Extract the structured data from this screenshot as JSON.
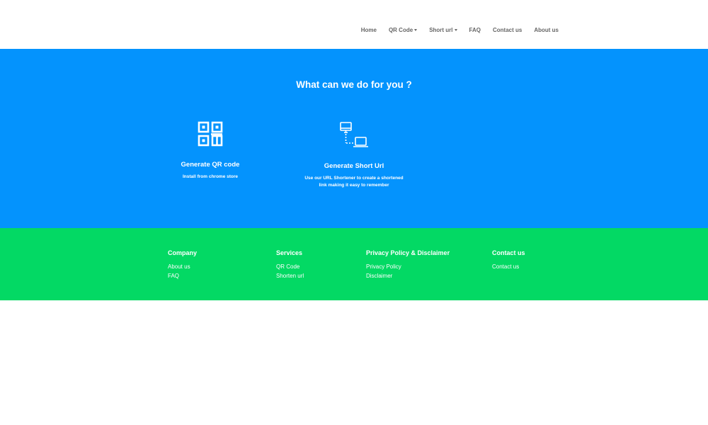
{
  "nav": {
    "items": [
      {
        "label": "Home",
        "dropdown": false
      },
      {
        "label": "QR Code",
        "dropdown": true
      },
      {
        "label": "Short url",
        "dropdown": true
      },
      {
        "label": "FAQ",
        "dropdown": false
      },
      {
        "label": "Contact us",
        "dropdown": false
      },
      {
        "label": "About us",
        "dropdown": false
      }
    ]
  },
  "services": {
    "title": "What can we do for you ?",
    "background_color": "#0493fd",
    "cards": [
      {
        "title": "Generate QR code",
        "desc_line1": "Install from chrome store",
        "desc_line2": "",
        "icon": "qr-code-icon"
      },
      {
        "title": "Generate Short Url",
        "desc_line1": "Use our URL Shortener to create a shortened",
        "desc_line2": "link making it easy to remember",
        "icon": "connected-devices-icon"
      }
    ]
  },
  "footer": {
    "background_color": "#03d964",
    "columns": [
      {
        "heading": "Company",
        "links": [
          "About us",
          "FAQ"
        ]
      },
      {
        "heading": "Services",
        "links": [
          "QR Code",
          "Shorten url"
        ]
      },
      {
        "heading": "Privacy Policy & Disclaimer",
        "links": [
          "Privacy Policy",
          "Disclaimer"
        ]
      },
      {
        "heading": "Contact us",
        "links": [
          "Contact us"
        ]
      }
    ]
  }
}
